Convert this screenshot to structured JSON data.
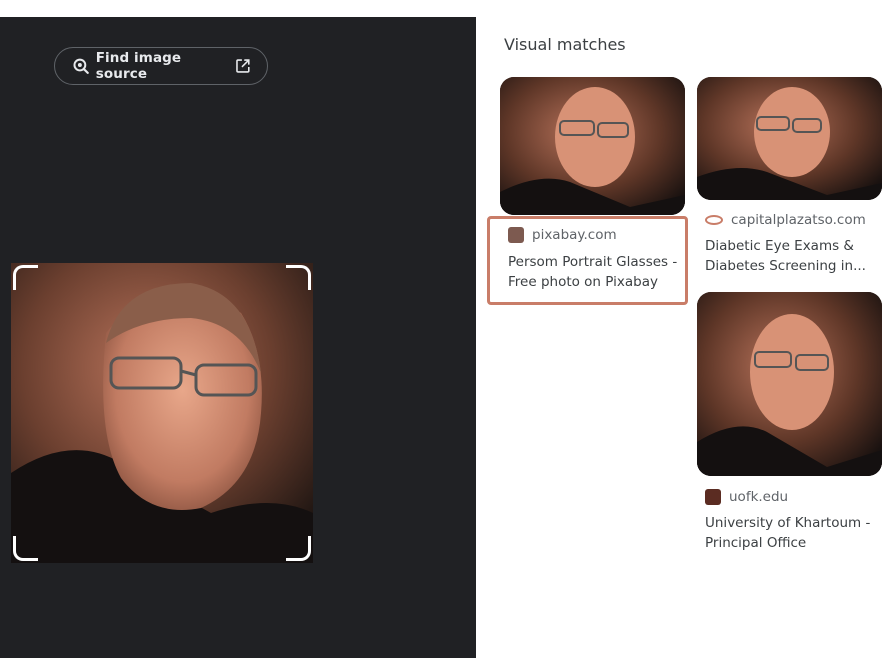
{
  "toolbar": {
    "find_source_label": "Find image source",
    "find_source_icon": "lens-search-icon",
    "external_link_icon": "external-link-icon"
  },
  "results": {
    "heading": "Visual matches",
    "items": [
      {
        "source": "pixabay.com",
        "title": "Persom Portrait Glasses - Free photo on Pixabay",
        "favicon": "pixabay-favicon",
        "highlighted": true
      },
      {
        "source": "capitalplazatso.com",
        "title": "Diabetic Eye Exams & Diabetes Screening in...",
        "favicon": "capitalplazatso-favicon",
        "highlighted": false
      },
      {
        "source": "uofk.edu",
        "title": "University of Khartoum - Principal Office",
        "favicon": "uofk-favicon",
        "highlighted": false
      }
    ]
  },
  "colors": {
    "left_bg": "#202124",
    "highlight_border": "#c97d68",
    "text": "#3c4043"
  }
}
